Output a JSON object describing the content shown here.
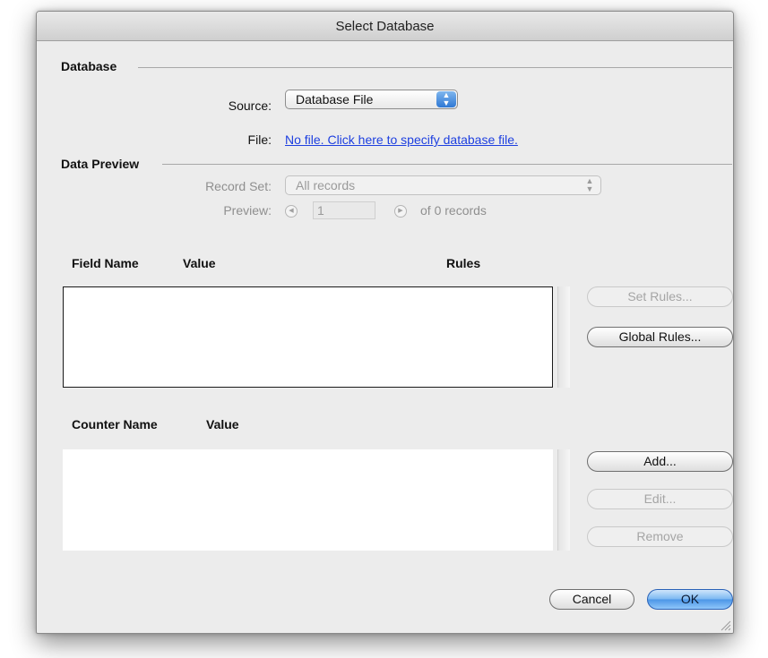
{
  "window": {
    "title": "Select Database"
  },
  "database": {
    "group_label": "Database",
    "source_label": "Source:",
    "source_value": "Database File",
    "file_label": "File:",
    "file_link": "No file. Click here to specify database file."
  },
  "preview": {
    "group_label": "Data Preview",
    "record_set_label": "Record Set:",
    "record_set_value": "All records",
    "preview_label": "Preview:",
    "record_index": "1",
    "record_count_text": "of 0 records"
  },
  "fields": {
    "col_field_name": "Field Name",
    "col_value": "Value",
    "col_rules": "Rules",
    "set_rules_button": "Set Rules...",
    "global_rules_button": "Global Rules..."
  },
  "counters": {
    "col_counter_name": "Counter Name",
    "col_value": "Value",
    "add_button": "Add...",
    "edit_button": "Edit...",
    "remove_button": "Remove"
  },
  "footer": {
    "cancel_button": "Cancel",
    "ok_button": "OK"
  },
  "colors": {
    "link": "#1d3fe0",
    "default_button": "#4b95e6",
    "window_bg": "#ececec"
  }
}
